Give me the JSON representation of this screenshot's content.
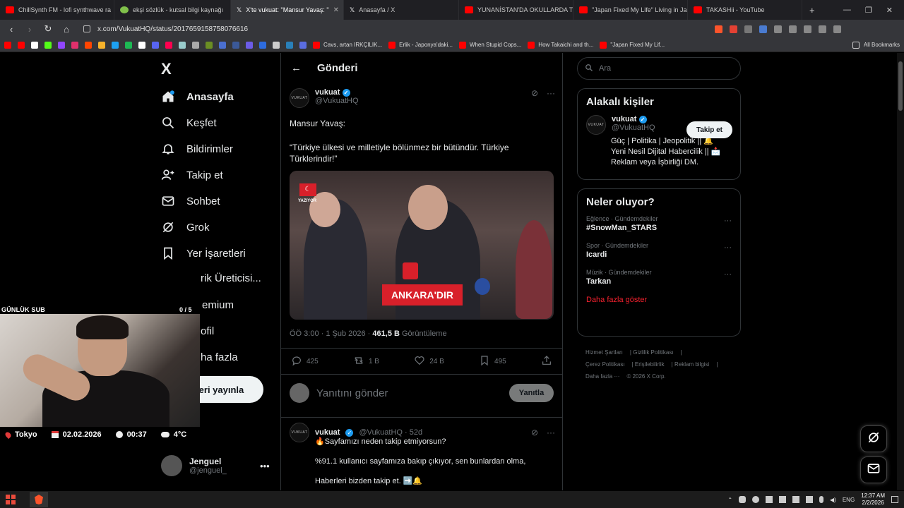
{
  "browser": {
    "tabs": [
      {
        "title": "ChillSynth FM - lofi synthwave ra",
        "color": "#ff0000",
        "active": false
      },
      {
        "title": "ekşi sözlük - kutsal bilgi kaynağı",
        "color": "#81c14b",
        "active": false
      },
      {
        "title": "X'te vukuat: \"Mansur Yavaş: \"",
        "color": "#ffffff",
        "active": true
      },
      {
        "title": "Anasayfa / X",
        "color": "#ffffff",
        "active": false
      },
      {
        "title": "YUNANİSTAN'DA OKULLARDA TÜRK",
        "color": "#ff0000",
        "active": false
      },
      {
        "title": "\"Japan Fixed My Life\" Living in Japan",
        "color": "#ff0000",
        "active": false
      },
      {
        "title": "TAKASHii - YouTube",
        "color": "#ff0000",
        "active": false
      }
    ],
    "url": "x.com/VukuatHQ/status/2017659158758076616",
    "bookmarks": [
      {
        "label": "Cavs, artan IRKÇILIK..."
      },
      {
        "label": "Erlik - Japonya'daki..."
      },
      {
        "label": "When Stupid Cops..."
      },
      {
        "label": "How Takaichi and th..."
      },
      {
        "label": "\"Japan Fixed My Lif..."
      }
    ],
    "all_bookmarks": "All Bookmarks"
  },
  "nav": {
    "logo": "X",
    "items": [
      {
        "label": "Anasayfa",
        "icon": "home-icon"
      },
      {
        "label": "Keşfet",
        "icon": "search-icon"
      },
      {
        "label": "Bildirimler",
        "icon": "bell-icon"
      },
      {
        "label": "Takip et",
        "icon": "follow-icon"
      },
      {
        "label": "Sohbet",
        "icon": "mail-icon"
      },
      {
        "label": "Grok",
        "icon": "grok-icon"
      },
      {
        "label": "Yer İşaretleri",
        "icon": "bookmark-icon"
      },
      {
        "label": "rik Üreticisi...",
        "icon": ""
      },
      {
        "label": "emium",
        "icon": ""
      },
      {
        "label": "ofil",
        "icon": ""
      },
      {
        "label": "ha fazla",
        "icon": ""
      }
    ],
    "post_button": "Gönderi yayınla",
    "profile": {
      "name": "Jenguel",
      "handle": "@jenguel_"
    }
  },
  "main": {
    "header_title": "Gönderi",
    "tweet": {
      "name": "vukuat",
      "handle": "@VukuatHQ",
      "avatar_text": "VUKUAT",
      "line1": "Mansur Yavaş:",
      "line2": "“Türkiye ülkesi ve milletiyle bölünmez bir bütündür. Türkiye Türklerindir!”",
      "media_banner": "ANKARA'DIR",
      "media_flag_label": "YAZIYOR",
      "time": "ÖÖ 3:00 · 1 Şub 2026 · ",
      "views_count": "461,5 B",
      "views_label": " Görüntüleme"
    },
    "actions": {
      "replies": "425",
      "reposts": "1 B",
      "likes": "24 B",
      "bookmarks": "495"
    },
    "reply_box": {
      "placeholder": "Yanıtını gönder",
      "button": "Yanıtla"
    },
    "reply2": {
      "name": "vukuat",
      "handle": "@VukuatHQ · 52d",
      "line1": "🔥Sayfamızı neden takip etmiyorsun?",
      "line2": "%91.1 kullanıcı sayfamıza bakıp çıkıyor, sen bunlardan olma,",
      "line3": "Haberleri bizden takip et. ➡️🔔"
    }
  },
  "right": {
    "search_placeholder": "Ara",
    "related": {
      "title": "Alakalı kişiler",
      "name": "vukuat",
      "handle": "@VukuatHQ",
      "follow": "Takip et",
      "bio1": "Güç | Politika | Jeopolitik || 🔔",
      "bio2": "Yeni Nesil Dijital Habercilik || 📩",
      "bio3": "Reklam veya İşbirliği DM."
    },
    "trends": {
      "title": "Neler oluyor?",
      "items": [
        {
          "category": "Eğlence · Gündemdekiler",
          "topic": "#SnowMan_STARS"
        },
        {
          "category": "Spor · Gündemdekiler",
          "topic": "Icardi"
        },
        {
          "category": "Müzik · Gündemdekiler",
          "topic": "Tarkan"
        }
      ],
      "more": "Daha fazla göster"
    },
    "footer": {
      "l1a": "Hizmet Şartları",
      "l1b": "Gizlilik Politikası",
      "l2a": "Çerez Politikası",
      "l2b": "Erişilebilirlik",
      "l2c": "Reklam bilgisi",
      "l3a": "Daha fazla ···",
      "l3b": "© 2026 X Corp."
    }
  },
  "overlay": {
    "sub_label": "GÜNLÜK SUB",
    "sub_count": "0 / 5",
    "location": "Tokyo",
    "date": "02.02.2026",
    "time": "00:37",
    "weather": "4°C"
  },
  "taskbar": {
    "lang": "ENG",
    "time": "12:37 AM",
    "date": "2/2/2026"
  }
}
